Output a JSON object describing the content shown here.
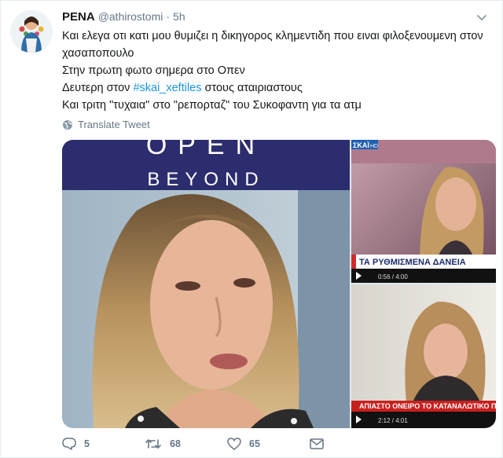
{
  "tweet": {
    "author": {
      "name": "PENA",
      "handle": "@athirostomi",
      "separator": "·",
      "time": "5h"
    },
    "text": {
      "line1": "Και ελεγα οτι κατι μου θυμιζει η δικηγορος κλημεντιδη που ειναι φιλοξενουμενη στον χασαποπουλο",
      "line2": "Στην πρωτη φωτο σημερα στο Οπεν",
      "line3_before": "Δευτερη στον ",
      "line3_hashtag": "#skai_xeftiles",
      "line3_after": " στους αταιριαστους",
      "line4": "Και τριτη \"τυχαια\" στο \"ρεπορταζ\" του Συκοφαντη για τα ατμ"
    },
    "translate_label": "Translate Tweet",
    "media": {
      "photo1_logo_top": "OPEN",
      "photo1_logo_bottom": "BEYOND",
      "photo2_channel": "ΣΚΑΪ",
      "photo2_channel_hd": "HD",
      "photo2_ticker": "ΤΑ ΡΥΘΜΙΣΜΕΝΑ ΔΑΝΕΙΑ",
      "photo2_video_time": "0:56 / 4:00",
      "photo3_ticker": "ΑΠΙΑΣΤΟ ΟΝΕΙΡΟ ΤΟ ΚΑΤΑΝΑΛΩΤΙΚΟ ΠΙ",
      "photo3_video_time": "2:12 / 4:01"
    },
    "actions": {
      "replies": "5",
      "retweets": "68",
      "likes": "65"
    },
    "colors": {
      "link": "#1b95e0",
      "secondary": "#657786",
      "primary": "#14171a"
    }
  }
}
